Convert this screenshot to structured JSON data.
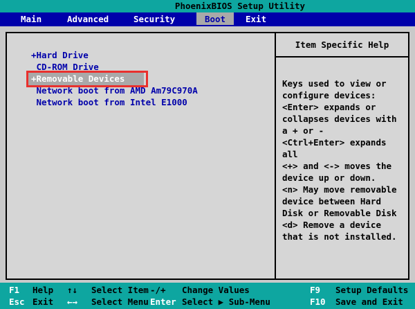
{
  "title_bar": {
    "title": "PhoenixBIOS Setup Utility"
  },
  "menu": {
    "tabs": [
      {
        "label": "Main",
        "selected": false
      },
      {
        "label": "Advanced",
        "selected": false
      },
      {
        "label": "Security",
        "selected": false
      },
      {
        "label": "Boot",
        "selected": true
      },
      {
        "label": "Exit",
        "selected": false
      }
    ]
  },
  "boot_list": {
    "items": [
      {
        "text": "+Hard Drive",
        "selected": false
      },
      {
        "text": " CD-ROM Drive",
        "selected": false
      },
      {
        "text": "+Removable Devices",
        "selected": true,
        "annotated": true
      },
      {
        "text": " Network boot from AMD Am79C970A",
        "selected": false
      },
      {
        "text": " Network boot from Intel E1000",
        "selected": false
      }
    ]
  },
  "help_panel": {
    "title": "Item Specific Help",
    "lines": [
      "Keys used to view or",
      "configure devices:",
      "<Enter> expands or",
      "collapses devices with",
      "a + or -",
      "<Ctrl+Enter> expands",
      "all",
      "<+> and <-> moves the",
      "device up or down.",
      "<n> May move removable",
      "device between Hard",
      "Disk or Removable Disk",
      "<d> Remove a device",
      "that is not installed."
    ]
  },
  "key_bar": {
    "rows": [
      [
        {
          "name": "f1",
          "key": "F1",
          "label": "Help",
          "white": true
        },
        {
          "name": "up-down",
          "key": "↑↓",
          "label": "Select Item",
          "white": false
        },
        {
          "name": "minus-plus",
          "key": "-/+",
          "label": "Change Values",
          "white": false
        },
        {
          "name": "f9",
          "key": "F9",
          "label": "Setup Defaults",
          "white": true
        }
      ],
      [
        {
          "name": "esc",
          "key": "Esc",
          "label": "Exit",
          "white": true
        },
        {
          "name": "left-right",
          "key": "←→",
          "label": "Select Menu",
          "white": true
        },
        {
          "name": "enter",
          "key": "Enter",
          "label": "Select ▶ Sub-Menu",
          "white": true
        },
        {
          "name": "f10",
          "key": "F10",
          "label": "Save and Exit",
          "white": true
        }
      ]
    ]
  },
  "colors": {
    "teal": "#0ea6a0",
    "menu_blue": "#0000aa",
    "item_blue": "#0000aa",
    "body_bg": "#d6d6d6",
    "outer_bg": "#c9c9c9",
    "highlight_grey": "#a9a9a9",
    "selected_text": "#ffffff",
    "annotation_red": "#e9302d",
    "text_black": "#000000",
    "key_white": "#ffffff"
  }
}
